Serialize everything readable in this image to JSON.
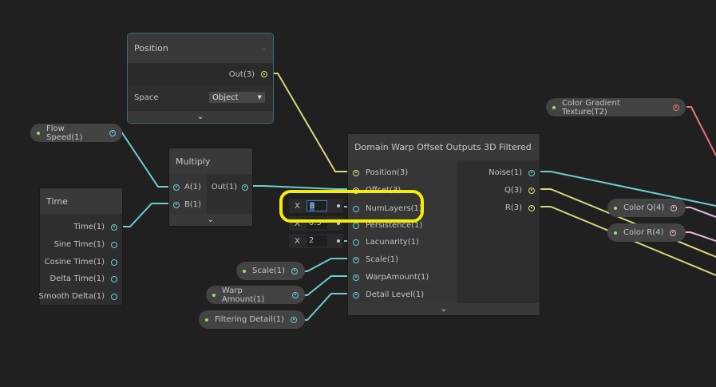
{
  "nodes": {
    "position": {
      "title": "Position",
      "output": "Out(3)",
      "space_label": "Space",
      "space_value": "Object"
    },
    "multiply": {
      "title": "Multiply",
      "inputs": [
        "A(1)",
        "B(1)"
      ],
      "output": "Out(1)"
    },
    "time": {
      "title": "Time",
      "outputs": [
        "Time(1)",
        "Sine Time(1)",
        "Cosine Time(1)",
        "Delta Time(1)",
        "Smooth Delta(1)"
      ]
    },
    "domain_warp": {
      "title": "Domain Warp Offset Outputs 3D Filtered",
      "inputs": [
        "Position(3)",
        "Offset(3)",
        "NumLayers(1)",
        "Persistence(1)",
        "Lacunarity(1)",
        "Scale(1)",
        "WarpAmount(1)",
        "Detail Level(1)"
      ],
      "outputs": [
        "Noise(1)",
        "Q(3)",
        "R(3)"
      ]
    }
  },
  "inline_fields": [
    {
      "axis": "X",
      "value": "8"
    },
    {
      "axis": "X",
      "value": "0.5"
    },
    {
      "axis": "X",
      "value": "2"
    }
  ],
  "properties": {
    "flow_speed": "Flow Speed(1)",
    "scale": "Scale(1)",
    "warp_amount": "Warp Amount(1)",
    "filtering_detail": "Filtering Detail(1)",
    "gradient": "Color Gradient Texture(T2)",
    "color_q": "Color Q(4)",
    "color_r": "Color R(4)"
  },
  "colors": {
    "float_port": "#6ccdd2",
    "vector3_port": "#e2e07a",
    "vector4_port": "#e7b6e0",
    "texture_port": "#e87575",
    "highlight": "#f5ee00"
  }
}
